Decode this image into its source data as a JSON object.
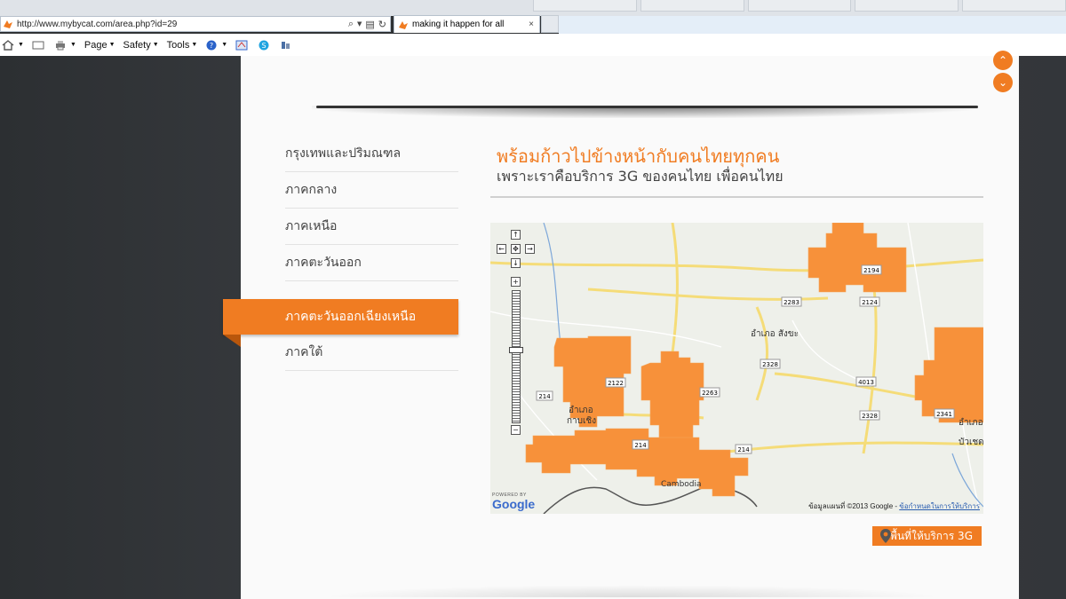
{
  "browser": {
    "url": "http://www.mybycat.com/area.php?id=29",
    "tab_title": "making it happen for all",
    "tab_close": "×",
    "commands": [
      {
        "label": "Page"
      },
      {
        "label": "Safety"
      },
      {
        "label": "Tools"
      }
    ]
  },
  "nav": {
    "items": [
      {
        "label": "กรุงเทพและปริมณฑล"
      },
      {
        "label": "ภาคกลาง"
      },
      {
        "label": "ภาคเหนือ"
      },
      {
        "label": "ภาคตะวันออก"
      },
      {
        "label": "ภาคตะวันออกเฉียงเหนือ"
      },
      {
        "label": "ภาคใต้"
      }
    ],
    "active_index": 4
  },
  "content": {
    "headline": "พร้อมก้าวไปข้างหน้ากับคนไทยทุกคน",
    "subhead": "เพราะเราคือบริการ 3G ของคนไทย เพื่อคนไทย"
  },
  "map": {
    "attribution": "ข้อมูลแผนที่ ©2013 Google - ",
    "attribution_link": "ข้อกำหนดในการให้บริการ",
    "powered_by": "POWERED BY",
    "powered_logo": "Google",
    "place_labels": [
      {
        "text": "อำเภอ สังขะ"
      },
      {
        "text": "อำเภอ"
      },
      {
        "text": "กาบเชิง"
      },
      {
        "text": "อำเภอ"
      },
      {
        "text": "บัวเชด"
      },
      {
        "text": "Cambodia"
      }
    ],
    "road_labels": [
      "2194",
      "2283",
      "2124",
      "2328",
      "4013",
      "2328",
      "2341",
      "2122",
      "2263",
      "214",
      "214",
      "214"
    ],
    "coverage_color": "#f7913a",
    "pan_controls": [
      "↑",
      "←",
      "✥",
      "→",
      "↓"
    ],
    "zoom_in": "+",
    "zoom_out": "−"
  },
  "legend": {
    "label": "พื้นที่ให้บริการ 3G",
    "icon": "map-pin-icon"
  },
  "scroll_buttons": {
    "up": "⌃",
    "down": "⌄"
  },
  "colors": {
    "accent": "#f07c22"
  }
}
